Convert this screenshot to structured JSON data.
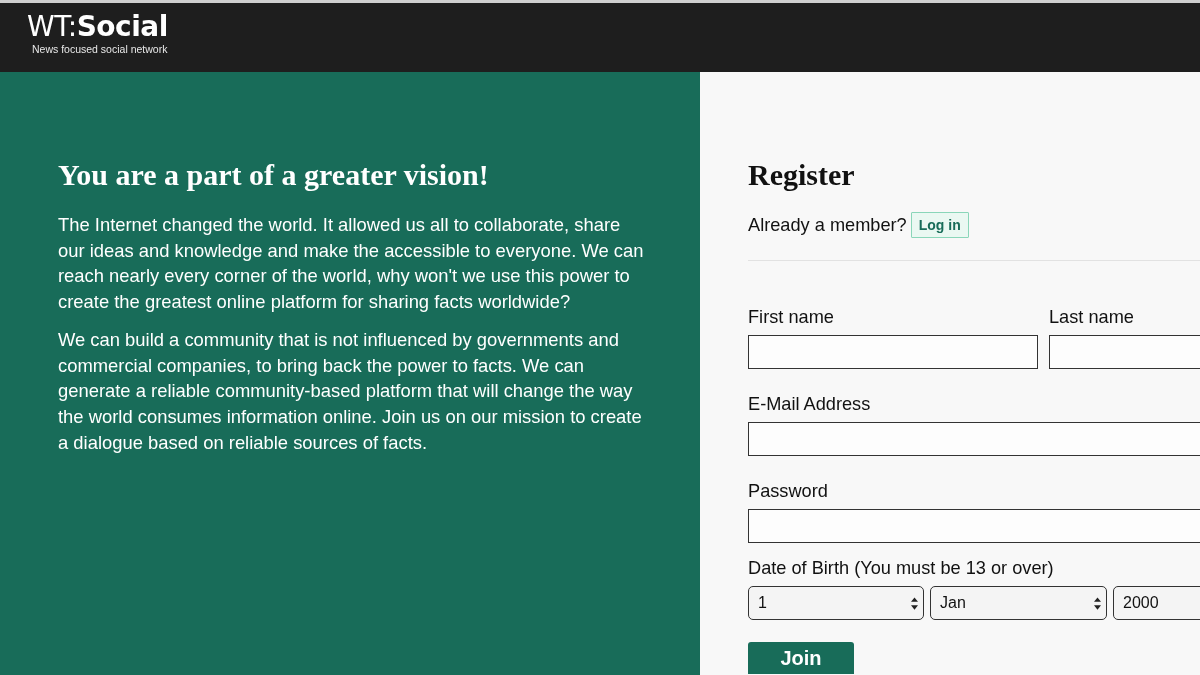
{
  "header": {
    "logo": "WT:**Social**",
    "tagline": "News focused social network"
  },
  "intro": {
    "title": "You are a part of a greater vision!",
    "paragraphs": [
      "The Internet changed the world. It allowed us all to collaborate, share our ideas and knowledge and make the accessible to everyone. We can reach nearly every corner of the world, why won't we use this power to create the greatest online platform for sharing facts worldwide?",
      "We can build a community that is not influenced by governments and commercial companies, to bring back the power to facts. We can generate a reliable community-based platform that will change the way the world consumes information online. Join us on our mission to create a dialogue based on reliable sources of facts."
    ]
  },
  "register": {
    "title": "Register",
    "member_prompt": "Already a member?",
    "login_button": "Log in",
    "name_fields": [
      {
        "label": "First name"
      },
      {
        "label": "Last name"
      }
    ],
    "fields": [
      {
        "label": "E-Mail Address"
      },
      {
        "label": "Password"
      }
    ],
    "date_of_birth": {
      "label": "Date of Birth (You must be 13 or over)",
      "selects": [
        {
          "value": "1"
        },
        {
          "value": "Jan"
        },
        {
          "value": "2000"
        }
      ]
    },
    "submit_button": "Join"
  }
}
